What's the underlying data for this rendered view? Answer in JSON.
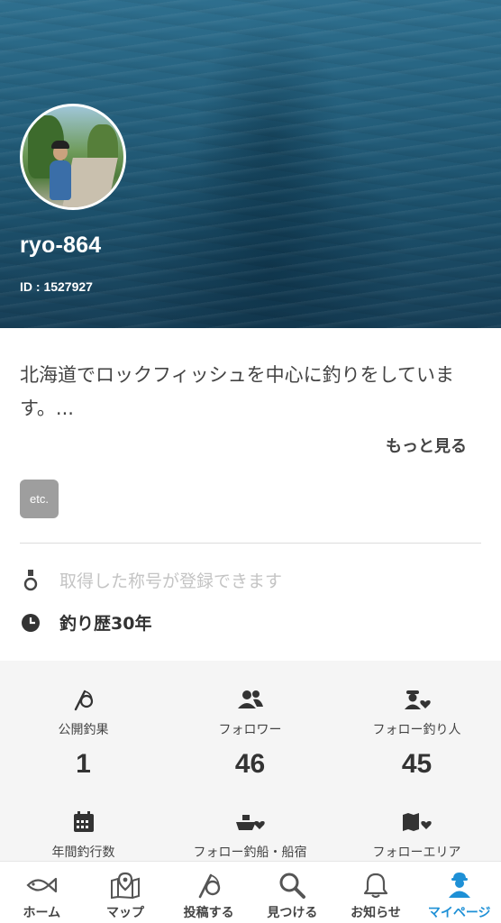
{
  "profile": {
    "username": "ryo-864",
    "user_id": "ID : 1527927",
    "bio": "北海道でロックフィッシュを中心に釣りをしています。...",
    "more_label": "もっと見る",
    "tag": "etc.",
    "title_placeholder": "取得した称号が登録できます",
    "career": "釣り歴30年"
  },
  "stats": [
    {
      "label": "公開釣果",
      "value": "1",
      "icon": "fishing-rod-icon"
    },
    {
      "label": "フォロワー",
      "value": "46",
      "icon": "followers-icon"
    },
    {
      "label": "フォロー釣り人",
      "value": "45",
      "icon": "follow-angler-icon"
    },
    {
      "label": "年間釣行数",
      "icon": "calendar-icon"
    },
    {
      "label": "フォロー釣船・船宿",
      "icon": "boat-heart-icon"
    },
    {
      "label": "フォローエリア",
      "icon": "map-heart-icon"
    }
  ],
  "nav": [
    {
      "label": "ホーム",
      "icon": "fish-icon"
    },
    {
      "label": "マップ",
      "icon": "map-pin-icon"
    },
    {
      "label": "投稿する",
      "icon": "fishing-rod-icon"
    },
    {
      "label": "見つける",
      "icon": "search-icon"
    },
    {
      "label": "お知らせ",
      "icon": "bell-icon"
    },
    {
      "label": "マイページ",
      "icon": "user-icon",
      "active": true
    }
  ],
  "colors": {
    "accent": "#1e90d6",
    "text": "#333333",
    "placeholder": "#c4c4c4",
    "stats_bg": "#f5f5f5"
  }
}
